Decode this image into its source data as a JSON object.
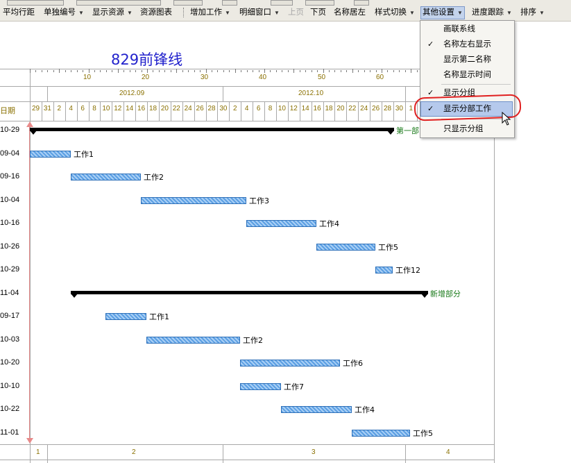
{
  "toolbar": {
    "items": [
      {
        "label": "平均行距",
        "dropdown": false,
        "enabled": true
      },
      {
        "label": "单独编号",
        "dropdown": true,
        "enabled": true
      },
      {
        "label": "显示资源",
        "dropdown": true,
        "enabled": true
      },
      {
        "label": "资源图表",
        "dropdown": false,
        "enabled": true
      },
      {
        "label": "增加工作",
        "dropdown": true,
        "enabled": true
      },
      {
        "label": "明细窗口",
        "dropdown": true,
        "enabled": true
      },
      {
        "label": "上页",
        "dropdown": false,
        "enabled": false
      },
      {
        "label": "下页",
        "dropdown": false,
        "enabled": true
      },
      {
        "label": "名称居左",
        "dropdown": false,
        "enabled": true
      },
      {
        "label": "样式切换",
        "dropdown": true,
        "enabled": true
      },
      {
        "label": "其他设置",
        "dropdown": true,
        "enabled": true,
        "active": true
      },
      {
        "label": "进度跟踪",
        "dropdown": true,
        "enabled": true
      },
      {
        "label": "排序",
        "dropdown": true,
        "enabled": true
      }
    ]
  },
  "chart_title": "829前锋线",
  "timescale": {
    "ruler_numbers": [
      "10",
      "20",
      "30",
      "40",
      "50",
      "60"
    ],
    "months": [
      "2012.09",
      "2012.10"
    ],
    "day_header_label": "日期",
    "days": [
      "29",
      "31",
      "2",
      "4",
      "6",
      "8",
      "10",
      "12",
      "14",
      "16",
      "18",
      "20",
      "22",
      "24",
      "26",
      "28",
      "30",
      "2",
      "4",
      "6",
      "8",
      "10",
      "12",
      "14",
      "16",
      "18",
      "20",
      "22",
      "24",
      "26",
      "28",
      "30",
      "1"
    ]
  },
  "rows": [
    {
      "date": "10-29",
      "kind": "summary",
      "label": "第一部"
    },
    {
      "date": "09-04",
      "kind": "task",
      "label": "工作1"
    },
    {
      "date": "09-16",
      "kind": "task",
      "label": "工作2"
    },
    {
      "date": "10-04",
      "kind": "task",
      "label": "工作3"
    },
    {
      "date": "10-16",
      "kind": "task",
      "label": "工作4"
    },
    {
      "date": "10-26",
      "kind": "task",
      "label": "工作5"
    },
    {
      "date": "10-29",
      "kind": "task",
      "label": "工作12"
    },
    {
      "date": "11-04",
      "kind": "summary",
      "label": "新增部分"
    },
    {
      "date": "09-17",
      "kind": "task",
      "label": "工作1"
    },
    {
      "date": "10-03",
      "kind": "task",
      "label": "工作2"
    },
    {
      "date": "10-20",
      "kind": "task",
      "label": "工作6"
    },
    {
      "date": "10-10",
      "kind": "task",
      "label": "工作7"
    },
    {
      "date": "10-22",
      "kind": "task",
      "label": "工作4"
    },
    {
      "date": "11-01",
      "kind": "task",
      "label": "工作5"
    }
  ],
  "bottom_scale": [
    "1",
    "2",
    "3",
    "4"
  ],
  "dropdown_menu": {
    "items": [
      {
        "label": "画联系线",
        "checked": false
      },
      {
        "label": "名称左右显示",
        "checked": true
      },
      {
        "label": "显示第二名称",
        "checked": false
      },
      {
        "label": "名称显示时间",
        "checked": false
      },
      {
        "label": "显示分组",
        "checked": true
      },
      {
        "label": "显示分部工作",
        "checked": true,
        "highlighted": true
      },
      {
        "label": "只显示分组",
        "checked": false
      }
    ],
    "check_glyph": "✓"
  },
  "colors": {
    "title": "#2222cc",
    "task_bar": "#5b9fe3",
    "summary_bar": "#000000",
    "summary_label": "#1a7a1a",
    "scale_text": "#8a7000",
    "menu_highlight": "#b5c9ec",
    "annotation_ring": "#e02020"
  }
}
